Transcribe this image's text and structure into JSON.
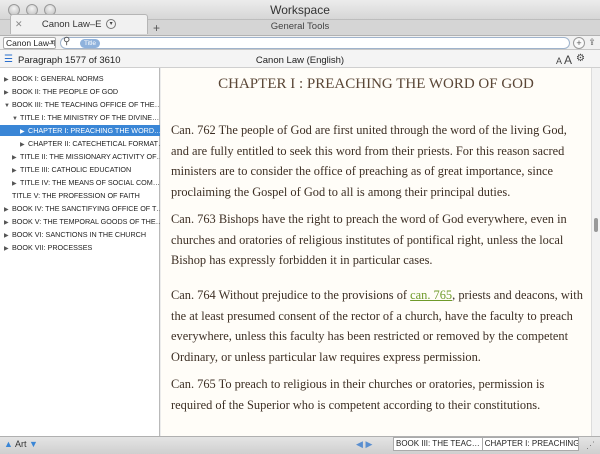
{
  "window": {
    "title": "Workspace",
    "subtitle": "General Tools"
  },
  "tab": {
    "label": "Canon Law–E",
    "close": "✕",
    "menu": "▾",
    "add": "+"
  },
  "toolbar": {
    "resource": "Canon Law–E",
    "search_token": "Title",
    "back": "‹",
    "forward": "›"
  },
  "infobar": {
    "paragraph": "Paragraph 1577 of 3610",
    "resource_name": "Canon Law (English)",
    "font_small": "A",
    "font_large": "A"
  },
  "toc": [
    {
      "label": "BOOK I: GENERAL NORMS",
      "tri": "▶"
    },
    {
      "label": "BOOK II: THE PEOPLE OF GOD",
      "tri": "▶"
    },
    {
      "label": "BOOK III: THE TEACHING OFFICE OF THE…",
      "tri": "▼"
    },
    {
      "label": "TITLE I: THE MINISTRY OF THE DIVINE…",
      "tri": "▼"
    },
    {
      "label": "CHAPTER I: PREACHING THE WORD…",
      "tri": "▶"
    },
    {
      "label": "CHAPTER II: CATECHETICAL FORMAT…",
      "tri": "▶"
    },
    {
      "label": "TITLE II: THE MISSIONARY ACTIVITY OF…",
      "tri": "▶"
    },
    {
      "label": "TITLE III: CATHOLIC EDUCATION",
      "tri": "▶"
    },
    {
      "label": "TITLE IV: THE MEANS OF SOCIAL COM…",
      "tri": "▶"
    },
    {
      "label": "TITLE V: THE PROFESSION OF FAITH",
      "tri": ""
    },
    {
      "label": "BOOK IV: THE SANCTIFYING OFFICE OF T…",
      "tri": "▶"
    },
    {
      "label": "BOOK V: THE TEMPORAL GOODS OF THE…",
      "tri": "▶"
    },
    {
      "label": "BOOK VI: SANCTIONS IN THE CHURCH",
      "tri": "▶"
    },
    {
      "label": "BOOK VII: PROCESSES",
      "tri": "▶"
    }
  ],
  "content": {
    "chapter_title": "CHAPTER I : PREACHING THE WORD OF GOD",
    "c762": "Can. 762 The people of God are first united through the word of the living God, and are fully entitled to seek this word from their priests. For this reason sacred ministers are to consider the office of preaching as of great importance, since proclaiming the Gospel of God to all is among their principal duties.",
    "c763": "Can. 763 Bishops have the right to preach the word of God everywhere, even in churches and oratories of religious institutes of pontifical right, unless the local Bishop has expressly forbidden it in particular cases.",
    "c764_pre": "Can. 764 Without prejudice to the provisions of ",
    "c764_link": "can. 765",
    "c764_post": ", priests and deacons, with the at least presumed consent of the rector of a church, have the faculty to preach everywhere, unless this faculty has been restricted or removed by the competent Ordinary, or unless particular law requires express permission.",
    "c765": "Can. 765 To preach to religious in their churches or oratories, permission is required of the Superior who is competent according to their constitutions."
  },
  "bottom": {
    "art_label": "Art",
    "crumb1": "BOOK III: THE TEAC…",
    "crumb2": "CHAPTER I: PREACHING THE…"
  }
}
